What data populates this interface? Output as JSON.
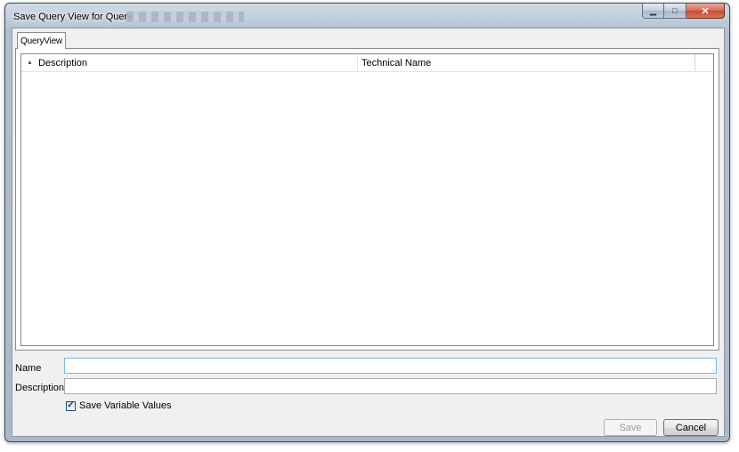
{
  "window": {
    "title": "Save Query View for Query",
    "minimize_glyph": "▁",
    "maximize_glyph": "□",
    "close_glyph": "✕"
  },
  "tabs": [
    {
      "label": "QueryView",
      "selected": true
    }
  ],
  "list": {
    "columns": [
      {
        "label": "Description",
        "sorted": "ascending",
        "sort_glyph": "▲"
      },
      {
        "label": "Technical Name"
      }
    ],
    "rows": []
  },
  "form": {
    "name_label": "Name",
    "name_value": "",
    "description_label": "Description",
    "description_value": "",
    "save_variable_values_label": "Save Variable Values",
    "save_variable_values_checked": true,
    "check_glyph": "✓"
  },
  "buttons": {
    "save_label": "Save",
    "save_enabled": false,
    "cancel_label": "Cancel"
  }
}
